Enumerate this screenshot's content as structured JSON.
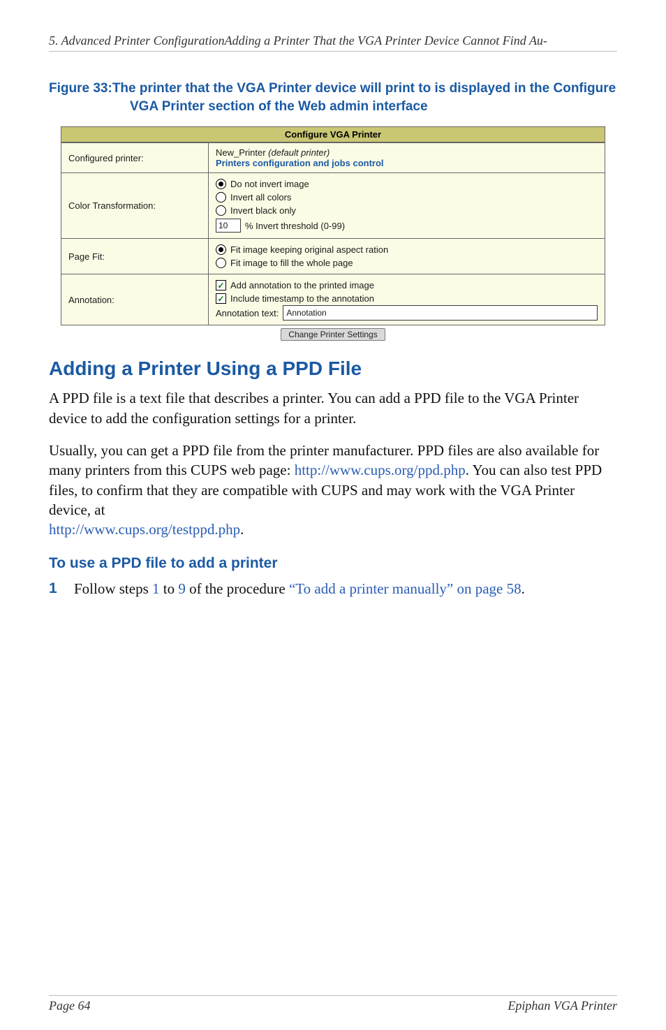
{
  "header": {
    "running": "5. Advanced Printer ConfigurationAdding a Printer That the VGA Printer Device Cannot Find Au-"
  },
  "figure": {
    "label": "Figure 33:",
    "caption": "The printer that the VGA Printer device will print to is displayed in the Configure VGA Printer section of the Web admin interface"
  },
  "cfg": {
    "title": "Configure VGA Printer",
    "rows": {
      "configured": {
        "label": "Configured printer:",
        "name": "New_Printer",
        "default_suffix": " (default printer)",
        "link": "Printers configuration and jobs control"
      },
      "color": {
        "label": "Color Transformation:",
        "opt1": "Do not invert image",
        "opt2": "Invert all colors",
        "opt3": "Invert black only",
        "pct_value": "10",
        "pct_text": "% Invert threshold (0-99)"
      },
      "fit": {
        "label": "Page Fit:",
        "opt1": "Fit image keeping original aspect ration",
        "opt2": "Fit image to fill the whole page"
      },
      "ann": {
        "label": "Annotation:",
        "chk1": "Add annotation to the printed image",
        "chk2": "Include timestamp to the annotation",
        "text_label": "Annotation text:",
        "text_value": "Annotation"
      }
    },
    "button": "Change Printer Settings"
  },
  "h2": "Adding a Printer Using a PPD File",
  "p1": "A PPD file is a text file that describes a printer. You can add a PPD file to the VGA Printer device to add the configuration settings for a printer.",
  "p2a": "Usually, you can get a PPD file from the printer manufacturer. PPD files are also available for many printers from this CUPS web page: ",
  "link1": "http://www.cups.org/ppd.php",
  "p2b": ". You can also test PPD files, to confirm that they are compatible with CUPS and may work with the VGA Printer device, at ",
  "link2": "http://www.cups.org/testppd.php",
  "p2c": ".",
  "h3": "To use a PPD file to add a printer",
  "step": {
    "num": "1",
    "a": "Follow steps ",
    "x1": "1",
    "b": " to ",
    "x2": "9",
    "c": " of the procedure ",
    "xref": "“To add a printer manually” on page 58",
    "d": "."
  },
  "footer": {
    "left": "Page 64",
    "right": "Epiphan VGA Printer"
  }
}
